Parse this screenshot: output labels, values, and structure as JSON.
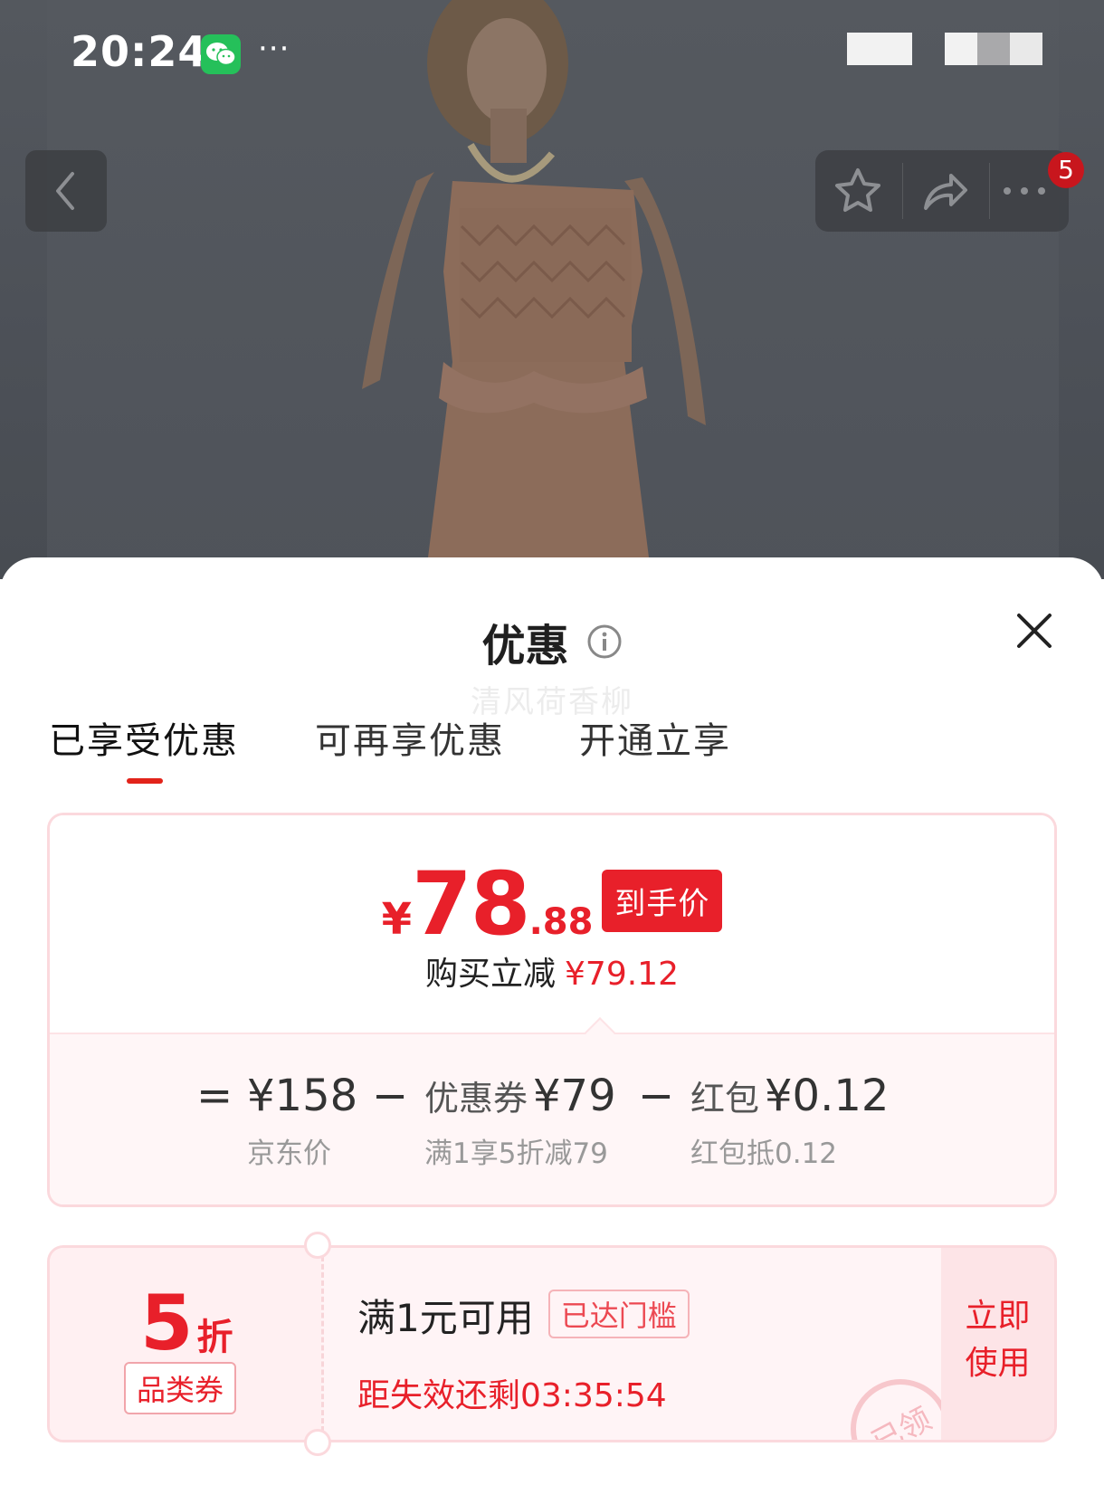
{
  "status_bar": {
    "time": "20:24",
    "more": "···"
  },
  "nav": {
    "cart_badge": "5"
  },
  "sheet": {
    "title": "优惠",
    "watermark": "清风荷香柳",
    "tabs": [
      {
        "label": "已享受优惠",
        "active": true
      },
      {
        "label": "可再享优惠",
        "active": false
      },
      {
        "label": "开通立享",
        "active": false
      }
    ]
  },
  "price": {
    "currency": "¥",
    "integer": "78",
    "decimal": ".88",
    "tag": "到手价",
    "save_label": "购买立减",
    "save_amount": "¥79.12",
    "formula": {
      "equals": "=",
      "minus": "−",
      "items": [
        {
          "label": "",
          "value": "¥158",
          "sub": "京东价"
        },
        {
          "label": "优惠券",
          "value": "¥79",
          "sub": "满1享5折减79"
        },
        {
          "label": "红包",
          "value": "¥0.12",
          "sub": "红包抵0.12"
        }
      ]
    }
  },
  "coupon": {
    "discount": "5",
    "discount_unit": "折",
    "category": "品类券",
    "condition": "满1元可用",
    "reached": "已达门槛",
    "expire": "距失效还剩03:35:54",
    "use_button": "立即\n使用",
    "use_line1": "立即",
    "use_line2": "使用",
    "stamp_text": "已领"
  },
  "colors": {
    "accent": "#e8202a",
    "card_border": "#fbd9dd",
    "card_bg": "#fff6f7"
  }
}
